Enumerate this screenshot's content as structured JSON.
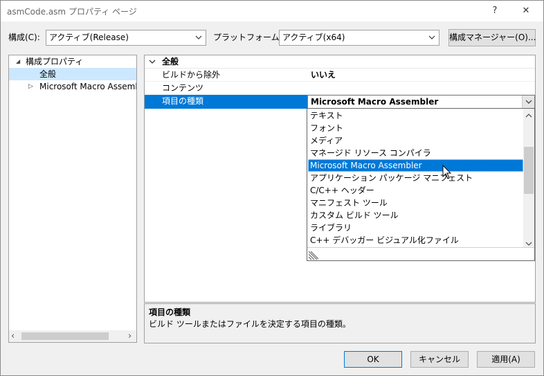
{
  "window": {
    "title": "asmCode.asm プロパティ ページ",
    "help": "?",
    "close": "✕"
  },
  "config": {
    "label": "構成(C):",
    "value": "アクティブ(Release)",
    "platform_label": "プラットフォーム(P):",
    "platform_value": "アクティブ(x64)",
    "manager_button": "構成マネージャー(O)..."
  },
  "tree": {
    "items": [
      {
        "label": "構成プロパティ",
        "toggle": "◢"
      },
      {
        "label": "全般"
      },
      {
        "label": "Microsoft Macro Assembler",
        "toggle": "▷"
      }
    ],
    "scroll_left": "‹",
    "scroll_right": "›"
  },
  "grid": {
    "category": "全般",
    "collapse": "∨",
    "rows": [
      {
        "name": "ビルドから除外",
        "value": "いいえ"
      },
      {
        "name": "コンテンツ",
        "value": ""
      },
      {
        "name": "項目の種類",
        "value": "Microsoft Macro Assembler"
      }
    ],
    "combo_chevron": "∨"
  },
  "dropdown": {
    "items": [
      "テキスト",
      "フォント",
      "メディア",
      "マネージド リソース コンパイラ",
      "Microsoft Macro Assembler",
      "アプリケーション パッケージ マニフェスト",
      "C/C++ ヘッダー",
      "マニフェスト ツール",
      "カスタム ビルド ツール",
      "ライブラリ",
      "C++ デバッガー ビジュアル化ファイル"
    ],
    "selected_index": 4,
    "scroll_up": "˄",
    "scroll_down": "˅"
  },
  "description": {
    "title": "項目の種類",
    "text": "ビルド ツールまたはファイルを決定する項目の種類。"
  },
  "buttons": {
    "ok": "OK",
    "cancel": "キャンセル",
    "apply": "適用(A)"
  },
  "colors": {
    "selection": "#0078d7",
    "tree_selection": "#cce8ff"
  }
}
